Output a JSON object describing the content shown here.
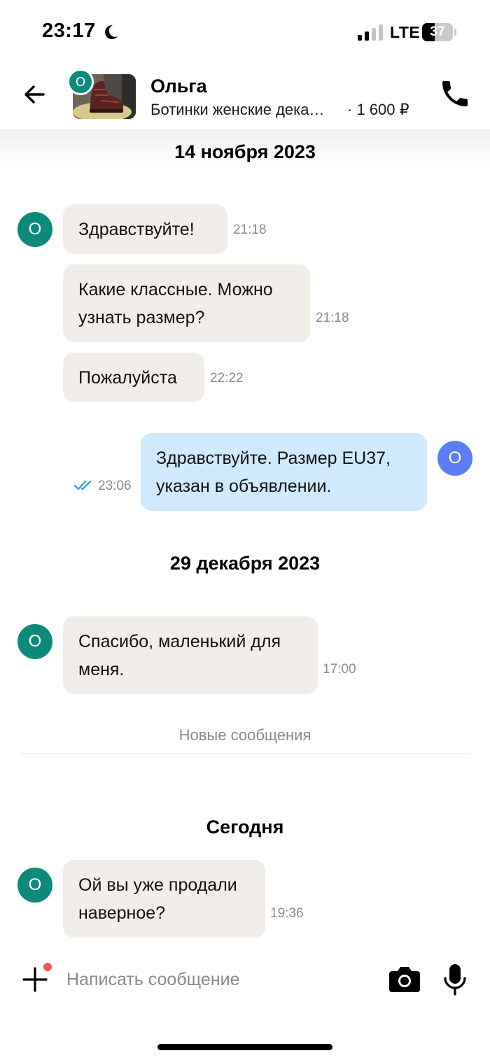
{
  "status_bar": {
    "time": "23:17",
    "network": "LTE",
    "battery": "37"
  },
  "header": {
    "seller_name": "Ольга",
    "seller_initial": "О",
    "item_title": "Ботинки женские дека…",
    "item_price": "· 1 600 ₽"
  },
  "chat": {
    "dates": [
      "14 ноября 2023",
      "29 декабря 2023",
      "Сегодня"
    ],
    "messages": [
      {
        "direction": "in",
        "avatar": "О",
        "text_lines": [
          "Здравствуйте!"
        ],
        "time": "21:18"
      },
      {
        "direction": "in",
        "text_lines": [
          "Какие классные. Можно",
          "узнать размер?"
        ],
        "time": "21:18"
      },
      {
        "direction": "in",
        "text_lines": [
          "Пожалуйста"
        ],
        "time": "22:22"
      },
      {
        "direction": "out",
        "avatar": "О",
        "text_lines": [
          "Здравствуйте. Размер EU37,",
          "указан в объявлении."
        ],
        "time": "23:06",
        "status": "read"
      },
      {
        "direction": "in",
        "avatar": "О",
        "text_lines": [
          "Спасибо, маленький для",
          "меня."
        ],
        "time": "17:00"
      },
      {
        "direction": "in",
        "avatar": "О",
        "text_lines": [
          "Ой вы уже продали",
          "наверное?"
        ],
        "time": "19:36"
      }
    ],
    "new_messages_label": "Новые сообщения"
  },
  "composer": {
    "placeholder": "Написать сообщение"
  },
  "icons": {
    "back": "arrow-left-icon",
    "call": "phone-icon",
    "add": "plus-icon",
    "camera": "camera-icon",
    "mic": "microphone-icon",
    "read": "double-check-icon"
  },
  "colors": {
    "avatar_teal": "#0e8a7c",
    "avatar_blue": "#5b7ef5",
    "bubble_in": "#f1eee9",
    "bubble_out": "#cfeafc",
    "read_check": "#3aa0e8"
  }
}
